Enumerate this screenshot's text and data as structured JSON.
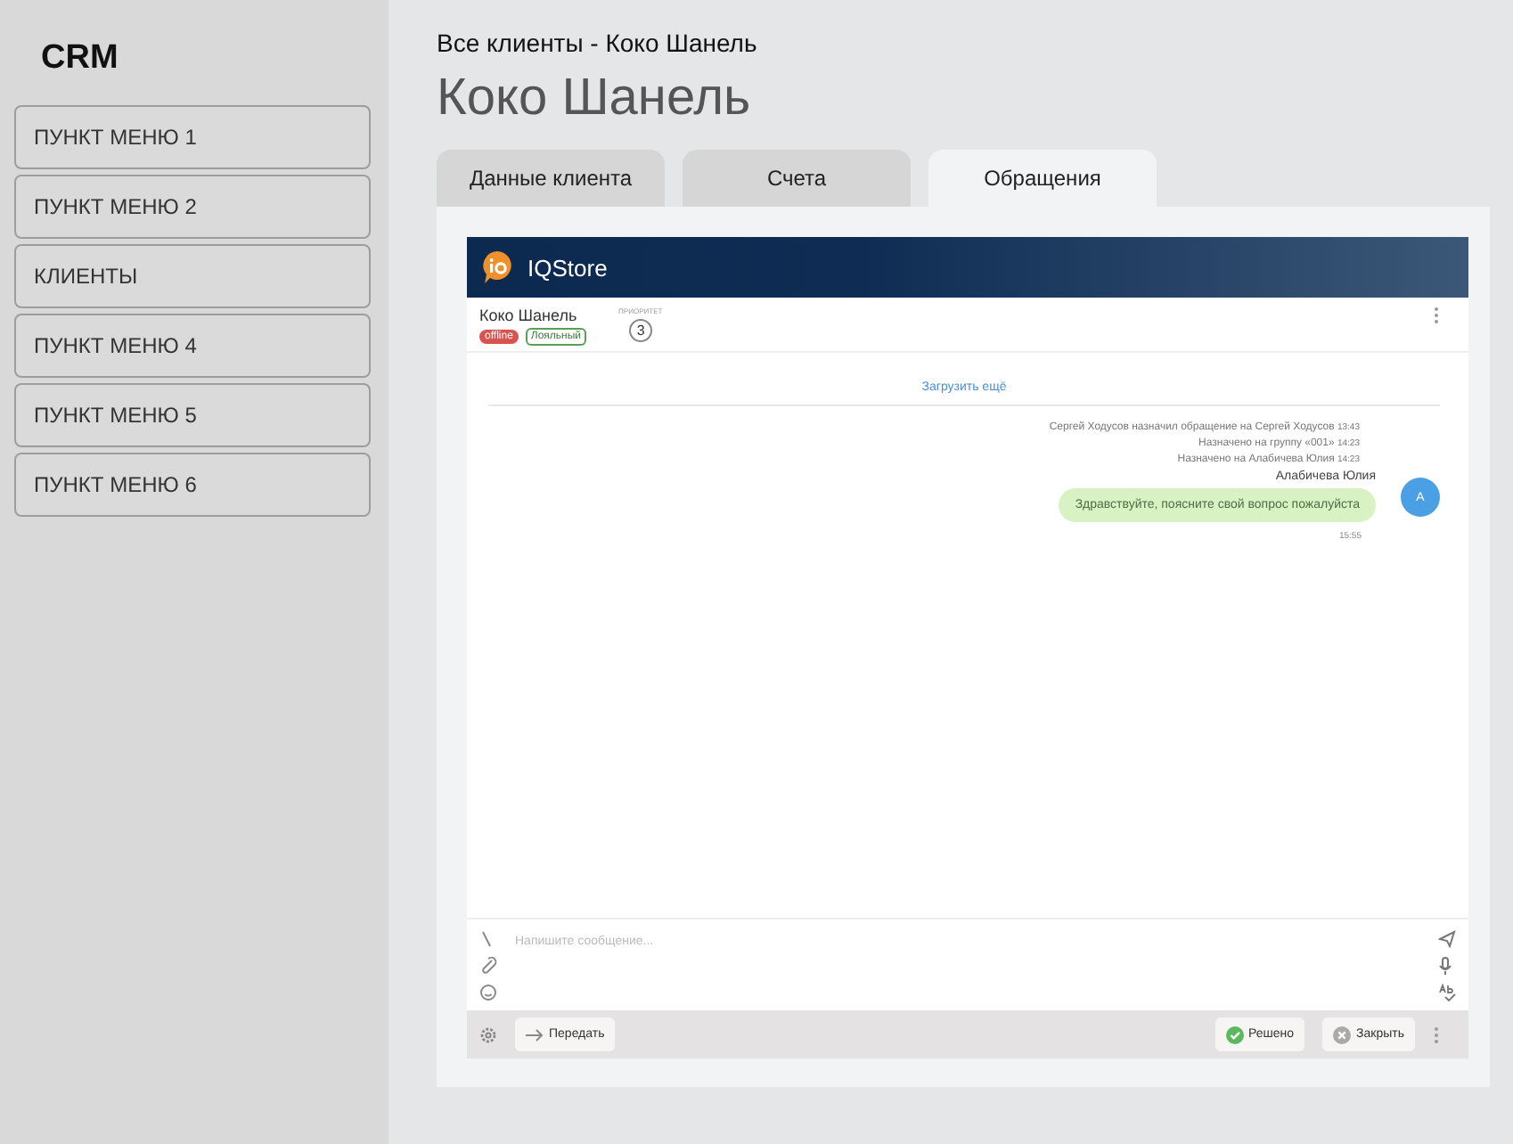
{
  "sidebar": {
    "logo": "CRM",
    "items": [
      {
        "label": "ПУНКТ МЕНЮ 1"
      },
      {
        "label": "ПУНКТ МЕНЮ 2"
      },
      {
        "label": "КЛИЕНТЫ"
      },
      {
        "label": "ПУНКТ МЕНЮ 4"
      },
      {
        "label": "ПУНКТ МЕНЮ 5"
      },
      {
        "label": "ПУНКТ МЕНЮ 6"
      }
    ]
  },
  "breadcrumb": "Все клиенты - Коко Шанель",
  "title": "Коко Шанель",
  "tabs": [
    {
      "label": "Данные клиента",
      "selected": false
    },
    {
      "label": "Счета",
      "selected": false
    },
    {
      "label": "Обращения",
      "selected": true
    }
  ],
  "chat": {
    "brand": "IQStore",
    "client": {
      "name": "Коко Шанель",
      "status": "offline",
      "tag": "Лояльный",
      "priority_label": "ПРИОРИТЕТ",
      "priority": "3"
    },
    "load_more": "Загрузить ещё",
    "events": [
      {
        "text": "Сергей Ходусов назначил обращение на Сергей Ходусов",
        "time": "13:43"
      },
      {
        "text": "Назначено на группу «001»",
        "time": "14:23"
      },
      {
        "text": "Назначено на Алабичева Юлия",
        "time": "14:23"
      }
    ],
    "message": {
      "author": "Алабичева Юлия",
      "avatar": "А",
      "text": "Здравствуйте, поясните свой вопрос пожалуйста",
      "time": "15:55"
    },
    "input": {
      "placeholder": "Напишите сообщение..."
    },
    "transfer": "Передать",
    "resolve": "Решено",
    "close": "Закрыть"
  }
}
